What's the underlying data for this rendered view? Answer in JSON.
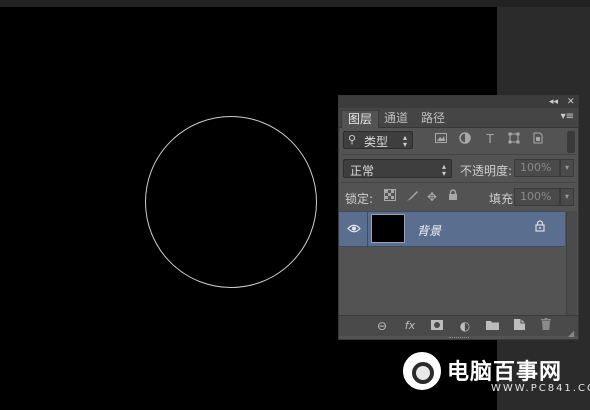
{
  "panel": {
    "collapse_icon": "double-chevron-left-icon",
    "close_icon": "close-icon",
    "tabs": [
      {
        "label": "图层",
        "active": true
      },
      {
        "label": "通道",
        "active": false
      },
      {
        "label": "路径",
        "active": false
      }
    ],
    "menu_icon": "panel-menu-icon"
  },
  "filter": {
    "search_icon": "search-icon",
    "label": "类型",
    "icons": [
      "image-filter-icon",
      "adjustment-filter-icon",
      "type-filter-icon",
      "shape-filter-icon",
      "smart-object-filter-icon"
    ]
  },
  "blend": {
    "mode": "正常",
    "opacity_label": "不透明度:",
    "opacity_value": "100%"
  },
  "lock": {
    "label": "锁定:",
    "icons": [
      "lock-transparency-icon",
      "lock-pixels-icon",
      "lock-position-icon",
      "lock-all-icon"
    ],
    "fill_label": "填充:",
    "fill_value": "100%"
  },
  "layers": [
    {
      "name": "背景",
      "visible": true,
      "locked": true,
      "selected": true
    }
  ],
  "bottom_icons": [
    "link-layers-icon",
    "fx-icon",
    "add-mask-icon",
    "adjustment-layer-icon",
    "new-group-icon",
    "new-layer-icon",
    "trash-icon"
  ],
  "watermark": {
    "name": "电脑百事网",
    "url": "WWW.PC841.COM"
  },
  "colors": {
    "canvas": "#000000",
    "panel": "#535353",
    "selected_layer": "#5a6e8f"
  }
}
